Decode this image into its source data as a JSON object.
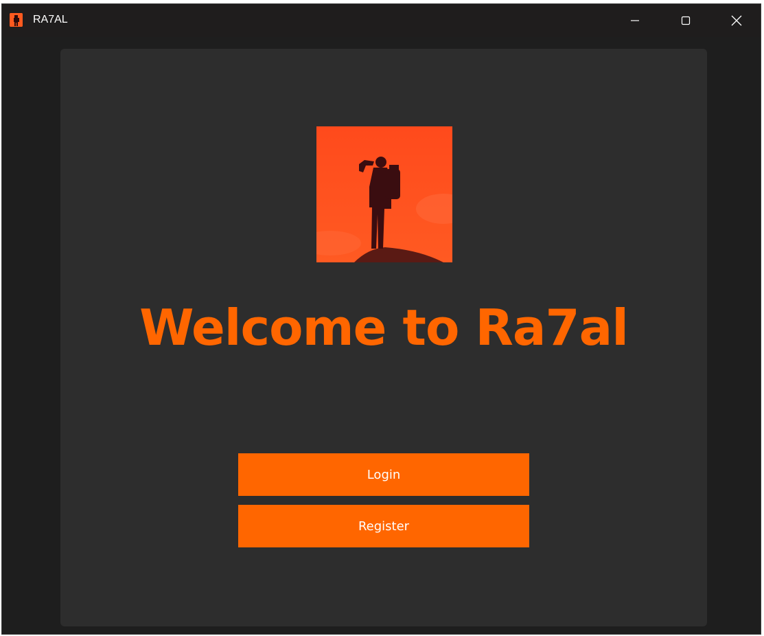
{
  "window": {
    "title": "RA7AL",
    "app_icon": "ra7al-logo-icon",
    "controls": [
      "minimize-icon",
      "maximize-icon",
      "close-icon"
    ]
  },
  "main": {
    "hero_image": "hiker-silhouette-on-orange",
    "welcome_title": "Welcome to Ra7al",
    "buttons": {
      "login_label": "Login",
      "register_label": "Register"
    }
  },
  "colors": {
    "accent": "#ff6600",
    "hero_bg": "#ff4a1c",
    "card_bg": "#2d2d2d",
    "window_bg": "#1e1e1e",
    "titlebar_bg": "#1f1d1d",
    "text_light": "#ffffff"
  }
}
